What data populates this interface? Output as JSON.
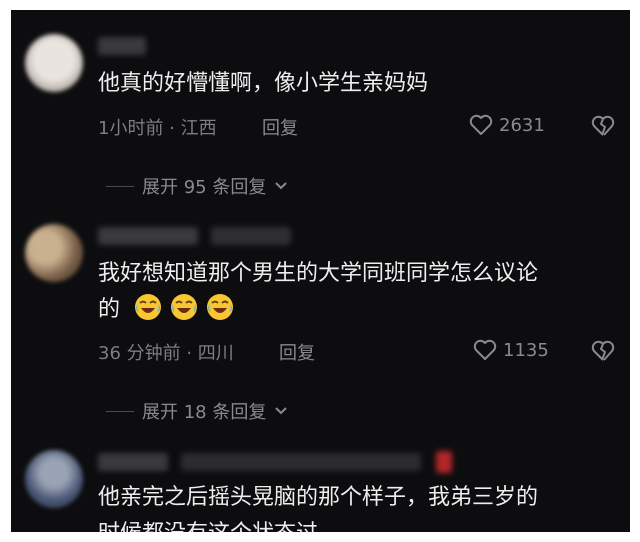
{
  "comments": [
    {
      "text_lines": [
        "他真的好懵懂啊，像小学生亲妈妈"
      ],
      "time_location": "1小时前 · 江西",
      "reply_label": "回复",
      "likes": "2631",
      "expand_label": "展开 95 条回复"
    },
    {
      "text_lines": [
        "我好想知道那个男生的大学同班同学怎么议论",
        "的"
      ],
      "emoji_icons": [
        "laugh-cry-emoji-icon",
        "laugh-cry-emoji-icon",
        "laugh-cry-emoji-icon"
      ],
      "time_location": "36 分钟前 · 四川",
      "reply_label": "回复",
      "likes": "1135",
      "expand_label": "展开 18 条回复"
    },
    {
      "text_lines": [
        "他亲完之后摇头晃脑的那个样子，我弟三岁的",
        "时候都没有这个状态过"
      ]
    }
  ],
  "colors": {
    "background": "#0d0d0f",
    "text": "#eeeeee",
    "meta": "#7d7d82"
  }
}
